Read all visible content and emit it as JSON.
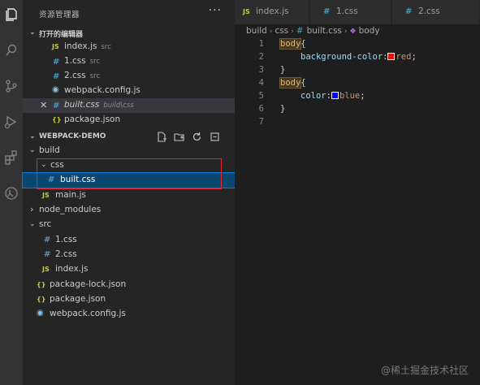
{
  "explorer": {
    "title": "资源管理器",
    "more": "···",
    "open_editors_label": "打开的编辑器",
    "open_editors": [
      {
        "icon": "js-file-icon",
        "glyph": "JS",
        "name": "index.js",
        "sub": "src"
      },
      {
        "icon": "css-file-icon",
        "glyph": "#",
        "name": "1.css",
        "sub": "src"
      },
      {
        "icon": "css-file-icon",
        "glyph": "#",
        "name": "2.css",
        "sub": "src"
      },
      {
        "icon": "webpack-icon",
        "glyph": "◉",
        "name": "webpack.config.js",
        "sub": ""
      },
      {
        "icon": "css-file-icon",
        "glyph": "#",
        "name": "built.css",
        "sub": "build\\css",
        "close": "✕"
      },
      {
        "icon": "json-file-icon",
        "glyph": "{}",
        "name": "package.json",
        "sub": ""
      }
    ],
    "project_label": "WEBPACK-DEMO",
    "tree": [
      {
        "glyph": "⌄",
        "name": "build"
      },
      {
        "glyph": "⌄",
        "name": "css"
      },
      {
        "glyph": "#",
        "name": "built.css"
      },
      {
        "glyph": "JS",
        "name": "main.js"
      },
      {
        "glyph": "›",
        "name": "node_modules"
      },
      {
        "glyph": "⌄",
        "name": "src"
      },
      {
        "glyph": "#",
        "name": "1.css"
      },
      {
        "glyph": "#",
        "name": "2.css"
      },
      {
        "glyph": "JS",
        "name": "index.js"
      },
      {
        "glyph": "{}",
        "name": "package-lock.json"
      },
      {
        "glyph": "{}",
        "name": "package.json"
      },
      {
        "glyph": "◉",
        "name": "webpack.config.js"
      }
    ]
  },
  "tabs": [
    {
      "glyph": "JS",
      "name": "index.js"
    },
    {
      "glyph": "#",
      "name": "1.css"
    },
    {
      "glyph": "#",
      "name": "2.css"
    }
  ],
  "breadcrumb": {
    "parts": [
      "build",
      "css",
      "built.css",
      "body"
    ],
    "sep": "›",
    "hash": "#",
    "sym": "❖"
  },
  "code": {
    "line_numbers": [
      "1",
      "2",
      "3",
      "4",
      "5",
      "6",
      "7"
    ],
    "lines": [
      {
        "selector": "body",
        "open": "{"
      },
      {
        "prop": "background-color",
        "colon": ":",
        "swatch": "#e51400",
        "value": "red",
        "semi": ";"
      },
      {
        "close": "}"
      },
      {
        "selector": "body",
        "open": "{"
      },
      {
        "prop": "color",
        "colon": ":",
        "swatch": "#0000ff",
        "value": "blue",
        "semi": ";"
      },
      {
        "close": "}"
      },
      {}
    ]
  },
  "watermark": "@稀土掘金技术社区",
  "colors": {
    "accent": "#007fd4",
    "highlight_box": "#e0262e",
    "selection": "#094771"
  }
}
